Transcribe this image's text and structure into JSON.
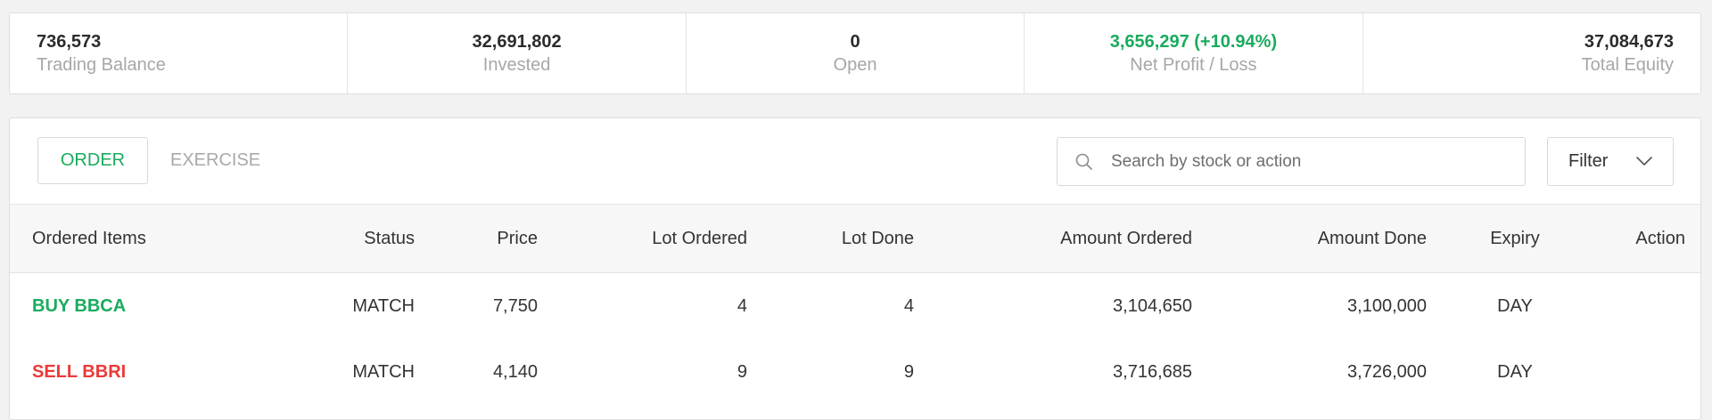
{
  "summary": {
    "trading_balance": {
      "value": "736,573",
      "label": "Trading Balance"
    },
    "invested": {
      "value": "32,691,802",
      "label": "Invested"
    },
    "open": {
      "value": "0",
      "label": "Open"
    },
    "net_profit_loss": {
      "value": "3,656,297 (+10.94%)",
      "label": "Net Profit / Loss"
    },
    "total_equity": {
      "value": "37,084,673",
      "label": "Total Equity"
    }
  },
  "tabs": {
    "order": "ORDER",
    "exercise": "EXERCISE"
  },
  "search": {
    "placeholder": "Search by stock or action",
    "icon": "search-icon"
  },
  "filter": {
    "label": "Filter",
    "icon": "chevron-down-icon"
  },
  "table": {
    "headers": {
      "ordered_items": "Ordered Items",
      "status": "Status",
      "price": "Price",
      "lot_ordered": "Lot Ordered",
      "lot_done": "Lot Done",
      "amount_ordered": "Amount Ordered",
      "amount_done": "Amount Done",
      "expiry": "Expiry",
      "action": "Action"
    },
    "rows": [
      {
        "item": "BUY BBCA",
        "status": "MATCH",
        "price": "7,750",
        "lot_ordered": "4",
        "lot_done": "4",
        "amount_ordered": "3,104,650",
        "amount_done": "3,100,000",
        "expiry": "DAY",
        "action": ""
      },
      {
        "item": "SELL BBRI",
        "status": "MATCH",
        "price": "4,140",
        "lot_ordered": "9",
        "lot_done": "9",
        "amount_ordered": "3,716,685",
        "amount_done": "3,726,000",
        "expiry": "DAY",
        "action": ""
      }
    ]
  },
  "colors": {
    "buy": "#1aab5e",
    "sell": "#ea3a3a",
    "profit": "#1aab5e",
    "muted": "#a7a7a7"
  }
}
